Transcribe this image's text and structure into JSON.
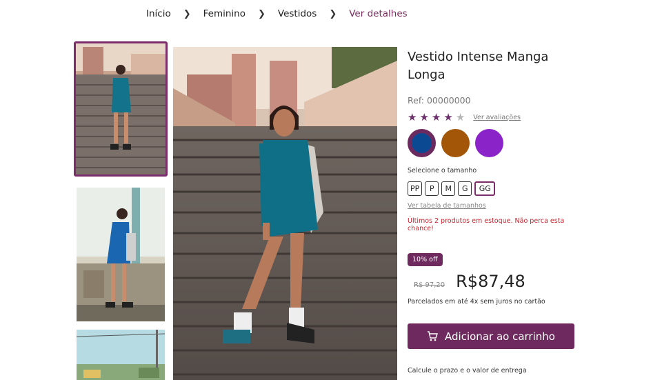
{
  "breadcrumb": {
    "items": [
      "Início",
      "Feminino",
      "Vestidos",
      "Ver detalhes"
    ],
    "separator": ">"
  },
  "product": {
    "title": "Vestido Intense Manga Longa",
    "ref": "Ref: 00000000",
    "rating": 4,
    "rating_max": 5,
    "reviews_link": "Ver avaliações",
    "colors": [
      {
        "name": "navy",
        "hex": "#0b4a93",
        "selected": true
      },
      {
        "name": "brown",
        "hex": "#a35607",
        "selected": false
      },
      {
        "name": "purple",
        "hex": "#8a24c9",
        "selected": false
      }
    ],
    "size_label": "Selecione o tamanho",
    "sizes": [
      "PP",
      "P",
      "M",
      "G",
      "GG"
    ],
    "selected_size": "GG",
    "size_table_link": "Ver tabela de tamanhos",
    "stock_message": "Últimos 2 produtos em estoque. Não perca esta chance!",
    "discount_badge": "10% off",
    "old_price": "R$ 97,20",
    "price": "R$87,48",
    "installments": "Parcelados em até 4x sem juros no cartão",
    "add_to_cart": "Adicionar ao carrinho",
    "shipping_text": "Calcule o prazo e o valor de entrega"
  },
  "colors": {
    "accent": "#6e2a5e",
    "stock_warning": "#c8232c"
  },
  "icons": {
    "breadcrumb_separator": "chevron-right-icon",
    "star": "star-icon",
    "cart": "cart-icon"
  }
}
